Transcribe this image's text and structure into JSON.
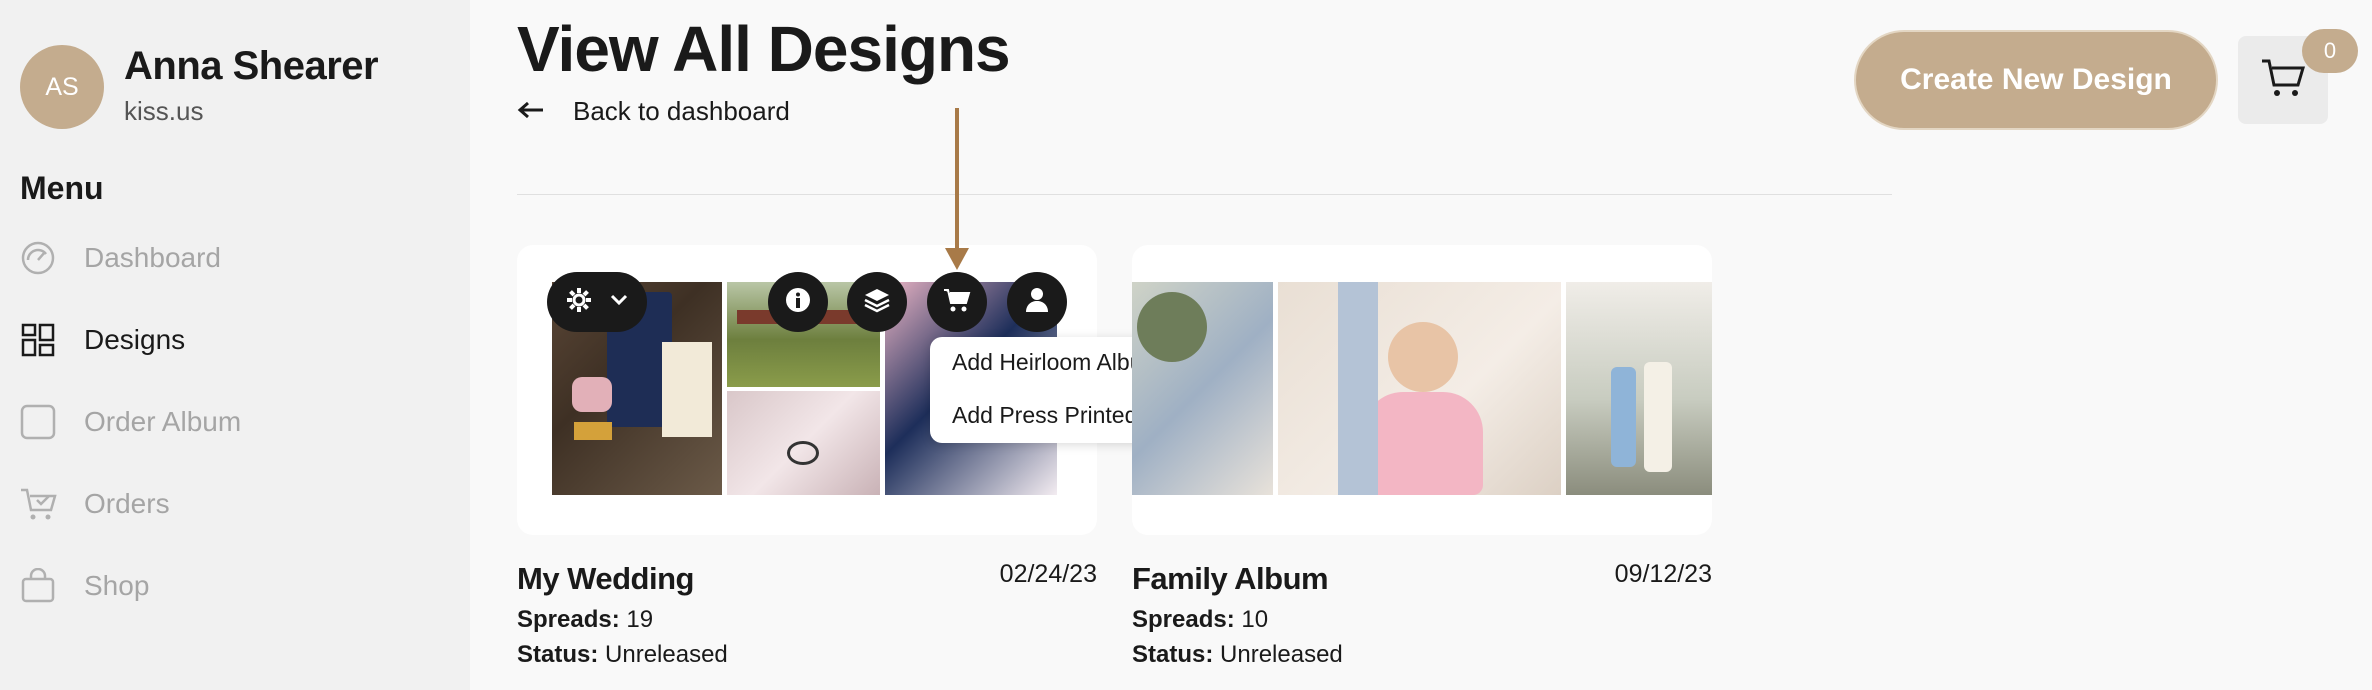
{
  "user": {
    "initials": "AS",
    "name": "Anna Shearer",
    "site": "kiss.us"
  },
  "sidebar": {
    "menu_title": "Menu",
    "items": [
      {
        "label": "Dashboard",
        "icon": "gauge-icon",
        "active": false
      },
      {
        "label": "Designs",
        "icon": "layout-grid-icon",
        "active": true
      },
      {
        "label": "Order Album",
        "icon": "square-outline-icon",
        "active": false
      },
      {
        "label": "Orders",
        "icon": "cart-check-icon",
        "active": false
      },
      {
        "label": "Shop",
        "icon": "shopping-bag-icon",
        "active": false
      }
    ]
  },
  "header": {
    "title": "View All Designs",
    "back_label": "Back to dashboard",
    "create_label": "Create New Design",
    "cart_count": "0"
  },
  "cart_menu": {
    "options": [
      "Add Heirloom Album to cart",
      "Add Press Printed Book to cart"
    ]
  },
  "designs": [
    {
      "title": "My Wedding",
      "date": "02/24/23",
      "spreads_label": "Spreads:",
      "spreads": "19",
      "status_label": "Status:",
      "status": "Unreleased"
    },
    {
      "title": "Family Album",
      "date": "09/12/23",
      "spreads_label": "Spreads:",
      "spreads": "10",
      "status_label": "Status:",
      "status": "Unreleased"
    }
  ],
  "colors": {
    "accent": "#c4ac8e",
    "annotation": "#a87a48",
    "dark": "#1a1a1a",
    "muted": "#a5a5a5"
  }
}
